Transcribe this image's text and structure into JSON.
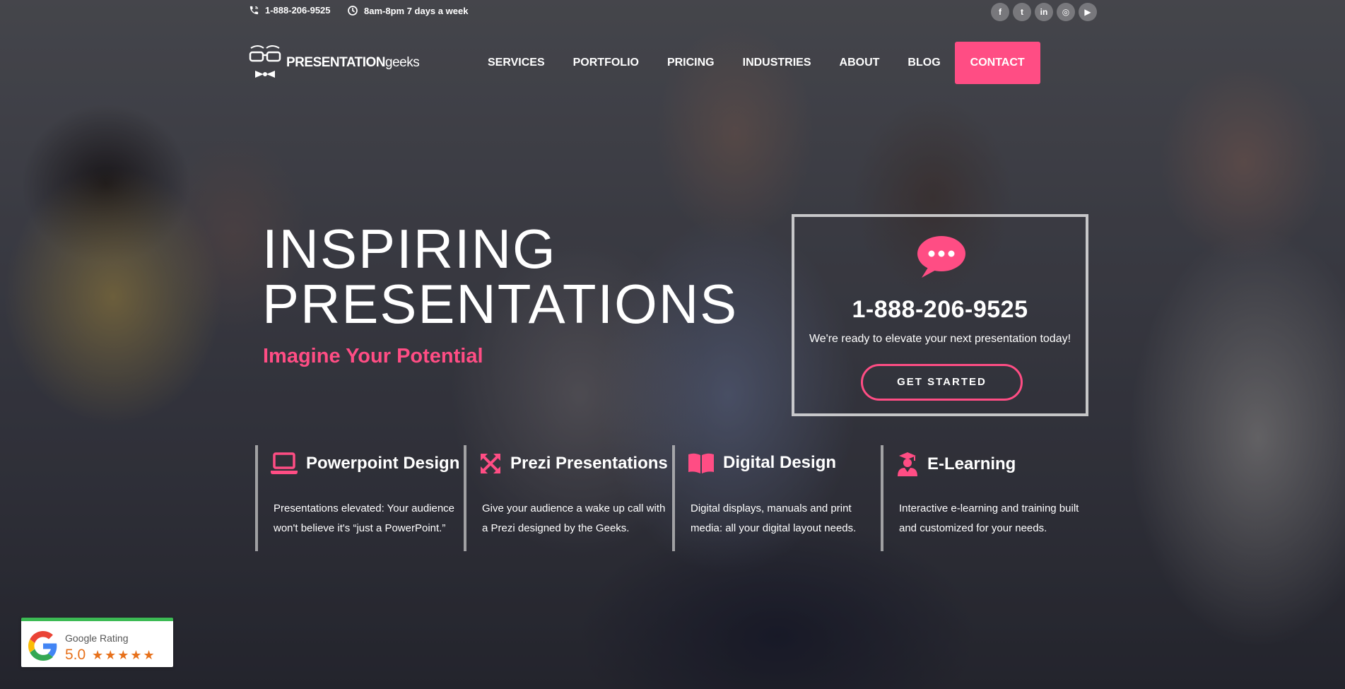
{
  "topbar": {
    "phone": "1-888-206-9525",
    "hours": "8am-8pm 7 days a week",
    "socials": [
      {
        "icon": "facebook-icon",
        "glyph": "f"
      },
      {
        "icon": "twitter-icon",
        "glyph": "t"
      },
      {
        "icon": "linkedin-icon",
        "glyph": "in"
      },
      {
        "icon": "instagram-icon",
        "glyph": "◎"
      },
      {
        "icon": "youtube-icon",
        "glyph": "▶"
      }
    ]
  },
  "logo": {
    "bold": "PRESENTATION",
    "light": "geeks"
  },
  "nav": {
    "items": [
      "SERVICES",
      "PORTFOLIO",
      "PRICING",
      "INDUSTRIES",
      "ABOUT",
      "BLOG"
    ],
    "contact": "CONTACT"
  },
  "hero": {
    "title_line1": "INSPIRING",
    "title_line2": "PRESENTATIONS",
    "subtitle": "Imagine Your Potential"
  },
  "cta": {
    "phone": "1-888-206-9525",
    "text": "We're ready to elevate your next presentation today!",
    "button": "GET STARTED"
  },
  "services": [
    {
      "icon": "laptop-icon",
      "title": "Powerpoint Design",
      "desc": "Presentations elevated: Your audience won't believe it's “just a PowerPoint.”"
    },
    {
      "icon": "expand-arrows-icon",
      "title": "Prezi Presentations",
      "desc": "Give your audience a wake up call with a Prezi designed by the Geeks."
    },
    {
      "icon": "book-icon",
      "title": "Digital Design",
      "desc": "Digital displays, manuals and  print media: all your digital layout needs."
    },
    {
      "icon": "graduate-icon",
      "title": "E-Learning",
      "desc": "Interactive e-learning  and training built and customized for your needs."
    }
  ],
  "google_rating": {
    "label": "Google Rating",
    "score": "5.0",
    "stars": "★★★★★"
  },
  "colors": {
    "accent": "#ff4d84",
    "google_green": "#3cba54",
    "star": "#e7711b"
  }
}
